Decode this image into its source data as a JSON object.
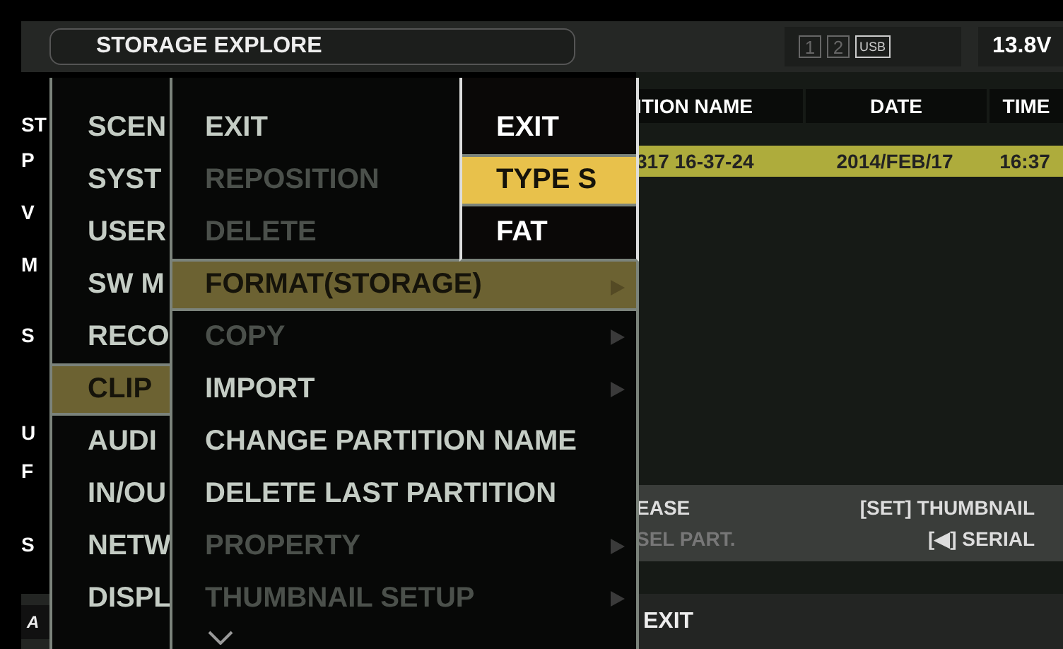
{
  "header": {
    "title": "STORAGE EXPLORE",
    "slots": [
      {
        "label": "1",
        "active": false
      },
      {
        "label": "2",
        "active": false
      },
      {
        "label": "USB",
        "active": true
      }
    ],
    "voltage": "13.8V"
  },
  "info_labels": [
    "ST",
    "P",
    "V",
    "M",
    "S",
    "U",
    "F",
    "S"
  ],
  "table": {
    "columns": [
      "ITION NAME",
      "DATE",
      "TIME"
    ],
    "rows": [
      {
        "cells": [
          "317 16-37-24",
          "2014/FEB/17",
          "16:37"
        ],
        "selected": true
      }
    ]
  },
  "help": [
    {
      "left": "EASE",
      "left_disabled": false,
      "right": "[SET] THUMBNAIL"
    },
    {
      "left": "SEL PART.",
      "left_disabled": true,
      "right": "[◀] SERIAL"
    }
  ],
  "footer": {
    "logo": [
      "A"
    ],
    "message": "EXIT"
  },
  "menus": [
    {
      "items": [
        {
          "label": "SCEN",
          "selected": false,
          "disabled": false,
          "submenu": false
        },
        {
          "label": "SYST",
          "selected": false,
          "disabled": false,
          "submenu": false
        },
        {
          "label": "USER",
          "selected": false,
          "disabled": false,
          "submenu": false
        },
        {
          "label": "SW M",
          "selected": false,
          "disabled": false,
          "submenu": false
        },
        {
          "label": "RECO",
          "selected": false,
          "disabled": false,
          "submenu": false
        },
        {
          "label": "CLIP",
          "selected": true,
          "disabled": false,
          "submenu": false
        },
        {
          "label": "AUDI",
          "selected": false,
          "disabled": false,
          "submenu": false
        },
        {
          "label": "IN/OU",
          "selected": false,
          "disabled": false,
          "submenu": false
        },
        {
          "label": "NETW",
          "selected": false,
          "disabled": false,
          "submenu": false
        },
        {
          "label": "DISPL",
          "selected": false,
          "disabled": false,
          "submenu": false
        }
      ]
    },
    {
      "more_below": true,
      "items": [
        {
          "label": "EXIT",
          "selected": false,
          "disabled": false,
          "submenu": false
        },
        {
          "label": "REPOSITION",
          "selected": false,
          "disabled": true,
          "submenu": false
        },
        {
          "label": "DELETE",
          "selected": false,
          "disabled": true,
          "submenu": false
        },
        {
          "label": "FORMAT(STORAGE)",
          "selected": true,
          "disabled": false,
          "submenu": true
        },
        {
          "label": "COPY",
          "selected": false,
          "disabled": true,
          "submenu": true
        },
        {
          "label": "IMPORT",
          "selected": false,
          "disabled": false,
          "submenu": true
        },
        {
          "label": "CHANGE PARTITION NAME",
          "selected": false,
          "disabled": false,
          "submenu": false
        },
        {
          "label": "DELETE LAST PARTITION",
          "selected": false,
          "disabled": false,
          "submenu": false
        },
        {
          "label": "PROPERTY",
          "selected": false,
          "disabled": true,
          "submenu": true
        },
        {
          "label": "THUMBNAIL SETUP",
          "selected": false,
          "disabled": true,
          "submenu": true
        }
      ]
    },
    {
      "items": [
        {
          "label": "EXIT",
          "selected": false,
          "disabled": false,
          "submenu": false
        },
        {
          "label": "TYPE S",
          "selected": true,
          "disabled": false,
          "submenu": false
        },
        {
          "label": "FAT",
          "selected": false,
          "disabled": false,
          "submenu": false
        }
      ]
    }
  ]
}
